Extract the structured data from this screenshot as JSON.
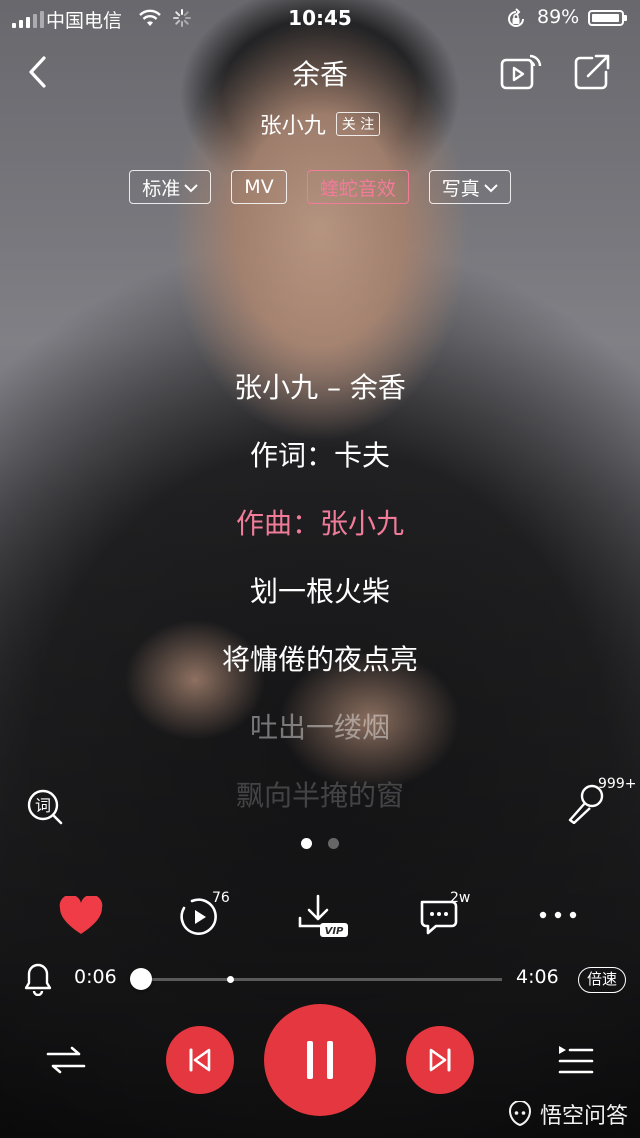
{
  "status_bar": {
    "carrier": "中国电信",
    "time": "10:45",
    "battery_pct": "89%",
    "battery_level": 0.89
  },
  "header": {
    "title": "余香",
    "artist": "张小九",
    "follow_label": "关 注"
  },
  "chips": [
    {
      "label": "标准",
      "dropdown": true,
      "active": false
    },
    {
      "label": "MV",
      "dropdown": false,
      "active": false
    },
    {
      "label": "蝰蛇音效",
      "dropdown": false,
      "active": true
    },
    {
      "label": "写真",
      "dropdown": true,
      "active": false
    }
  ],
  "lyrics": [
    {
      "text": "张小九 – 余香",
      "state": "normal"
    },
    {
      "text": "作词：卡夫",
      "state": "normal"
    },
    {
      "text": "作曲：张小九",
      "state": "current"
    },
    {
      "text": "划一根火柴",
      "state": "normal"
    },
    {
      "text": "将慵倦的夜点亮",
      "state": "normal"
    },
    {
      "text": "吐出一缕烟",
      "state": "dim"
    },
    {
      "text": "飘向半掩的窗",
      "state": "faint"
    }
  ],
  "karaoke": {
    "count": "999+"
  },
  "pager": {
    "total": 2,
    "active": 0
  },
  "actions": {
    "mv_count": "76",
    "comment_count": "2w",
    "vip_label": "VIP"
  },
  "progress": {
    "current": "0:06",
    "total": "4:06",
    "played_fraction": 0.024,
    "marker_fraction": 0.265
  },
  "speed_label": "倍速",
  "watermark": {
    "text": "悟空问答"
  },
  "colors": {
    "accent_pink": "#f07c9a",
    "player_red": "#e5373f",
    "heart_red": "#f03c46"
  }
}
